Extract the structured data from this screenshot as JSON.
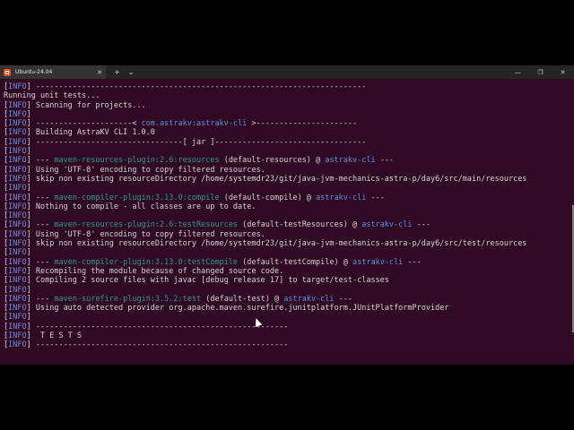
{
  "window": {
    "tab_title": "Ubuntu-24.04",
    "tab_close": "✕",
    "new_tab": "+",
    "dropdown": "⌄",
    "minimize": "—",
    "maximize": "❐",
    "close": "✕"
  },
  "terminal": {
    "tag": "INFO",
    "lines": [
      {
        "type": "info",
        "text": "------------------------------------------------------------------------"
      },
      {
        "type": "plain",
        "text": "Running unit tests..."
      },
      {
        "type": "info",
        "text": "Scanning for projects..."
      },
      {
        "type": "info",
        "text": ""
      },
      {
        "type": "artifact",
        "pre": "---------------------< ",
        "artifact": "com.astrakv:astrakv-cli",
        "post": " >----------------------"
      },
      {
        "type": "info",
        "text": "Building AstraKV CLI 1.0.0"
      },
      {
        "type": "info",
        "text": "--------------------------------[ jar ]---------------------------------"
      },
      {
        "type": "info",
        "text": ""
      },
      {
        "type": "plugin",
        "plugin": "maven-resources-plugin:2.6:resources",
        "goal": " (default-resources) @ ",
        "project": "astrakv-cli"
      },
      {
        "type": "info",
        "text": "Using 'UTF-8' encoding to copy filtered resources."
      },
      {
        "type": "info",
        "text": "skip non existing resourceDirectory /home/systemdr23/git/java-jvm-mechanics-astra-p/day6/src/main/resources"
      },
      {
        "type": "info",
        "text": ""
      },
      {
        "type": "plugin",
        "plugin": "maven-compiler-plugin:3.13.0:compile",
        "goal": " (default-compile) @ ",
        "project": "astrakv-cli"
      },
      {
        "type": "info",
        "text": "Nothing to compile - all classes are up to date."
      },
      {
        "type": "info",
        "text": ""
      },
      {
        "type": "plugin",
        "plugin": "maven-resources-plugin:2.6:testResources",
        "goal": " (default-testResources) @ ",
        "project": "astrakv-cli"
      },
      {
        "type": "info",
        "text": "Using 'UTF-8' encoding to copy filtered resources."
      },
      {
        "type": "info",
        "text": "skip non existing resourceDirectory /home/systemdr23/git/java-jvm-mechanics-astra-p/day6/src/test/resources"
      },
      {
        "type": "info",
        "text": ""
      },
      {
        "type": "plugin",
        "plugin": "maven-compiler-plugin:3.13.0:testCompile",
        "goal": " (default-testCompile) @ ",
        "project": "astrakv-cli"
      },
      {
        "type": "info",
        "text": "Recompiling the module because of changed source code."
      },
      {
        "type": "info",
        "text": "Compiling 2 source files with javac [debug release 17] to target/test-classes"
      },
      {
        "type": "info",
        "text": ""
      },
      {
        "type": "plugin",
        "plugin": "maven-surefire-plugin:3.5.2:test",
        "goal": " (default-test) @ ",
        "project": "astrakv-cli"
      },
      {
        "type": "info",
        "text": "Using auto detected provider org.apache.maven.surefire.junitplatform.JUnitPlatformProvider"
      },
      {
        "type": "info",
        "text": ""
      },
      {
        "type": "info",
        "text": "-------------------------------------------------------"
      },
      {
        "type": "info",
        "text": " T E S T S"
      },
      {
        "type": "info",
        "text": "-------------------------------------------------------"
      }
    ]
  }
}
